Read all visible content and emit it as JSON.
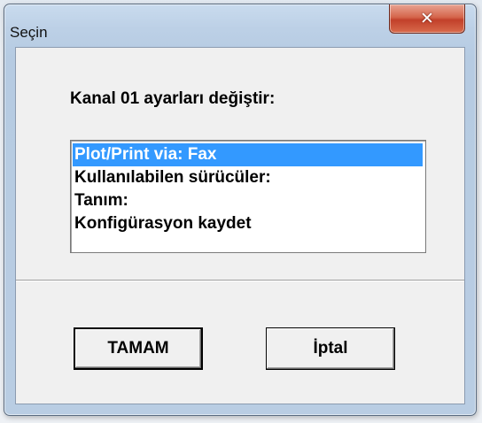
{
  "window": {
    "title": "Seçin",
    "close_glyph": "✕"
  },
  "dialog": {
    "prompt": "Kanal 01 ayarları değiştir:",
    "list_items": [
      {
        "label": "Plot/Print via: Fax",
        "selected": true
      },
      {
        "label": "Kullanılabilen sürücüler:",
        "selected": false
      },
      {
        "label": "Tanım:",
        "selected": false
      },
      {
        "label": "Konfigürasyon kaydet",
        "selected": false
      }
    ],
    "ok_label": "TAMAM",
    "cancel_label": "İptal"
  },
  "colors": {
    "selection": "#3399ff",
    "close_button": "#c2402a",
    "title_frame": "#bcd0e6"
  },
  "icons": {
    "close": "close-icon"
  }
}
